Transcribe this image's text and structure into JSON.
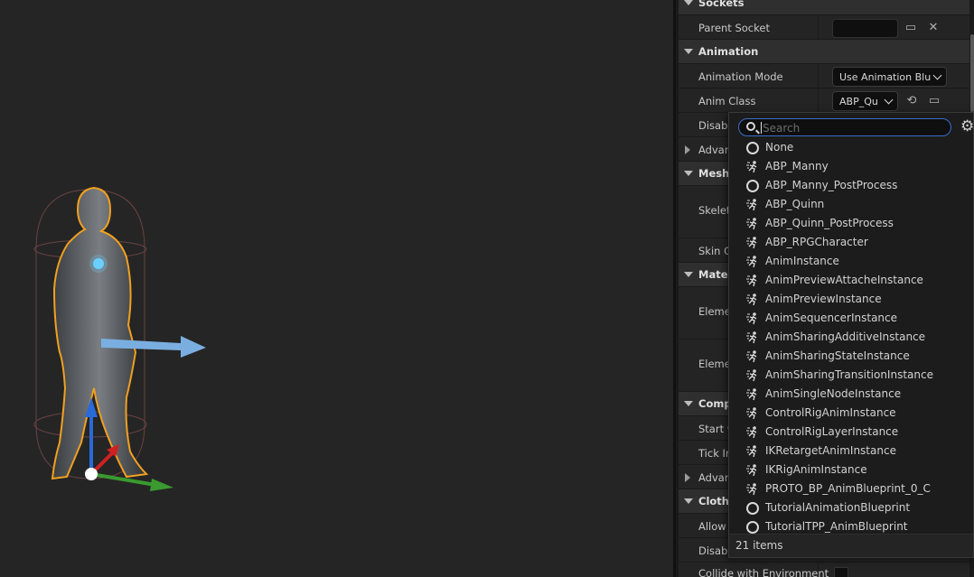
{
  "details": {
    "sections": {
      "sockets": "Sockets",
      "animation": "Animation",
      "mesh": "Mesh",
      "materials": "Materia",
      "component": "Compo",
      "clothing": "Clothin"
    },
    "rows": {
      "parent_socket": "Parent Socket",
      "animation_mode": "Animation Mode",
      "animation_mode_value": "Use Animation Blu",
      "anim_class": "Anim Class",
      "anim_class_value": "ABP_Qu",
      "disable": "Disable",
      "advanced": "Advanc",
      "skeletal": "Skeleta",
      "skin_cache": "Skin Ca",
      "element0": "Elemen",
      "element1": "Elemen",
      "start_w": "Start w",
      "tick_in": "Tick In",
      "advanced2": "Advanc",
      "allow_c": "Allow C",
      "disable2": "Disable",
      "collide": "Collide with Environment"
    }
  },
  "picker": {
    "search_placeholder": "Search",
    "search_value": "",
    "items": [
      {
        "label": "None",
        "icon": "circle-icon"
      },
      {
        "label": "ABP_Manny",
        "icon": "anim-blueprint-icon"
      },
      {
        "label": "ABP_Manny_PostProcess",
        "icon": "circle-icon"
      },
      {
        "label": "ABP_Quinn",
        "icon": "anim-blueprint-icon"
      },
      {
        "label": "ABP_Quinn_PostProcess",
        "icon": "anim-blueprint-icon"
      },
      {
        "label": "ABP_RPGCharacter",
        "icon": "anim-blueprint-icon"
      },
      {
        "label": "AnimInstance",
        "icon": "anim-blueprint-icon"
      },
      {
        "label": "AnimPreviewAttacheInstance",
        "icon": "anim-blueprint-icon"
      },
      {
        "label": "AnimPreviewInstance",
        "icon": "anim-blueprint-icon"
      },
      {
        "label": "AnimSequencerInstance",
        "icon": "anim-blueprint-icon"
      },
      {
        "label": "AnimSharingAdditiveInstance",
        "icon": "anim-blueprint-icon"
      },
      {
        "label": "AnimSharingStateInstance",
        "icon": "anim-blueprint-icon"
      },
      {
        "label": "AnimSharingTransitionInstance",
        "icon": "anim-blueprint-icon"
      },
      {
        "label": "AnimSingleNodeInstance",
        "icon": "anim-blueprint-icon"
      },
      {
        "label": "ControlRigAnimInstance",
        "icon": "anim-blueprint-icon"
      },
      {
        "label": "ControlRigLayerInstance",
        "icon": "anim-blueprint-icon"
      },
      {
        "label": "IKRetargetAnimInstance",
        "icon": "anim-blueprint-icon"
      },
      {
        "label": "IKRigAnimInstance",
        "icon": "anim-blueprint-icon"
      },
      {
        "label": "PROTO_BP_AnimBlueprint_0_C",
        "icon": "anim-blueprint-icon"
      },
      {
        "label": "TutorialAnimationBlueprint",
        "icon": "circle-icon"
      },
      {
        "label": "TutorialTPP_AnimBlueprint",
        "icon": "circle-icon"
      }
    ],
    "footer": "21 items"
  },
  "colors": {
    "selection_outline": "#f0a020",
    "gizmo_x": "#3a9a30",
    "gizmo_y": "#d02020",
    "gizmo_z": "#2a6ad8",
    "search_focus": "#3c6cc8"
  }
}
